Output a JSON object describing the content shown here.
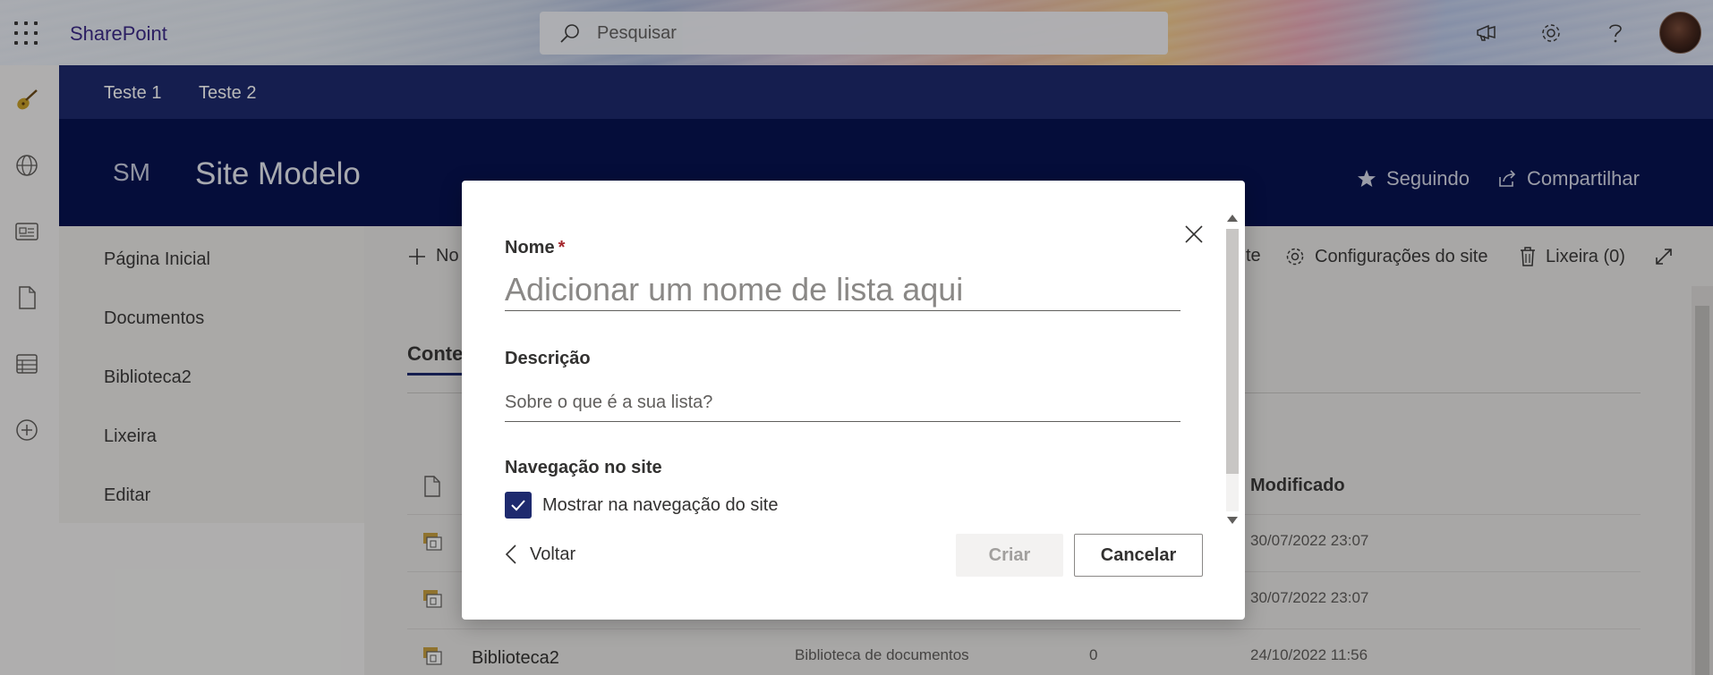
{
  "suitebar": {
    "brand": "SharePoint",
    "search_placeholder": "Pesquisar",
    "icons": [
      "waffle-icon",
      "megaphone-icon",
      "gear-icon",
      "help-icon",
      "avatar"
    ]
  },
  "appbar": {
    "icons": [
      "guitar-icon",
      "globe-icon",
      "news-icon",
      "file-icon",
      "list-icon",
      "add-icon"
    ]
  },
  "hubnav": {
    "items": [
      "Teste 1",
      "Teste 2"
    ]
  },
  "site": {
    "logo": "SM",
    "title": "Site Modelo",
    "following": "Seguindo",
    "share": "Compartilhar"
  },
  "leftnav": {
    "items": [
      "Página Inicial",
      "Documentos",
      "Biblioteca2",
      "Lixeira",
      "Editar"
    ]
  },
  "commandbar": {
    "new_partial": "No",
    "partial_left": "te",
    "site_settings": "Configurações do site",
    "recycle_bin": "Lixeira (0)"
  },
  "content": {
    "tab": "Conte",
    "column_modified": "Modificado",
    "rows": [
      {
        "name": "",
        "type": "",
        "count": "",
        "modified": "30/07/2022 23:07"
      },
      {
        "name": "",
        "type": "",
        "count": "",
        "modified": "30/07/2022 23:07"
      },
      {
        "name": "Biblioteca2",
        "type": "Biblioteca de documentos",
        "count": "0",
        "modified": "24/10/2022 11:56"
      }
    ]
  },
  "dialog": {
    "name_label": "Nome",
    "required_mark": "*",
    "name_placeholder": "Adicionar um nome de lista aqui",
    "description_label": "Descrição",
    "description_placeholder": "Sobre o que é a sua lista?",
    "navigation_label": "Navegação no site",
    "show_in_nav_label": "Mostrar na navegação do site",
    "show_in_nav_checked": true,
    "back": "Voltar",
    "create": "Criar",
    "cancel": "Cancelar"
  },
  "colors": {
    "brand": "#3c2a88",
    "hub_nav": "#1e2a6e",
    "site_header": "#071351",
    "checkbox": "#1e2a6e",
    "required": "#a4262c"
  }
}
